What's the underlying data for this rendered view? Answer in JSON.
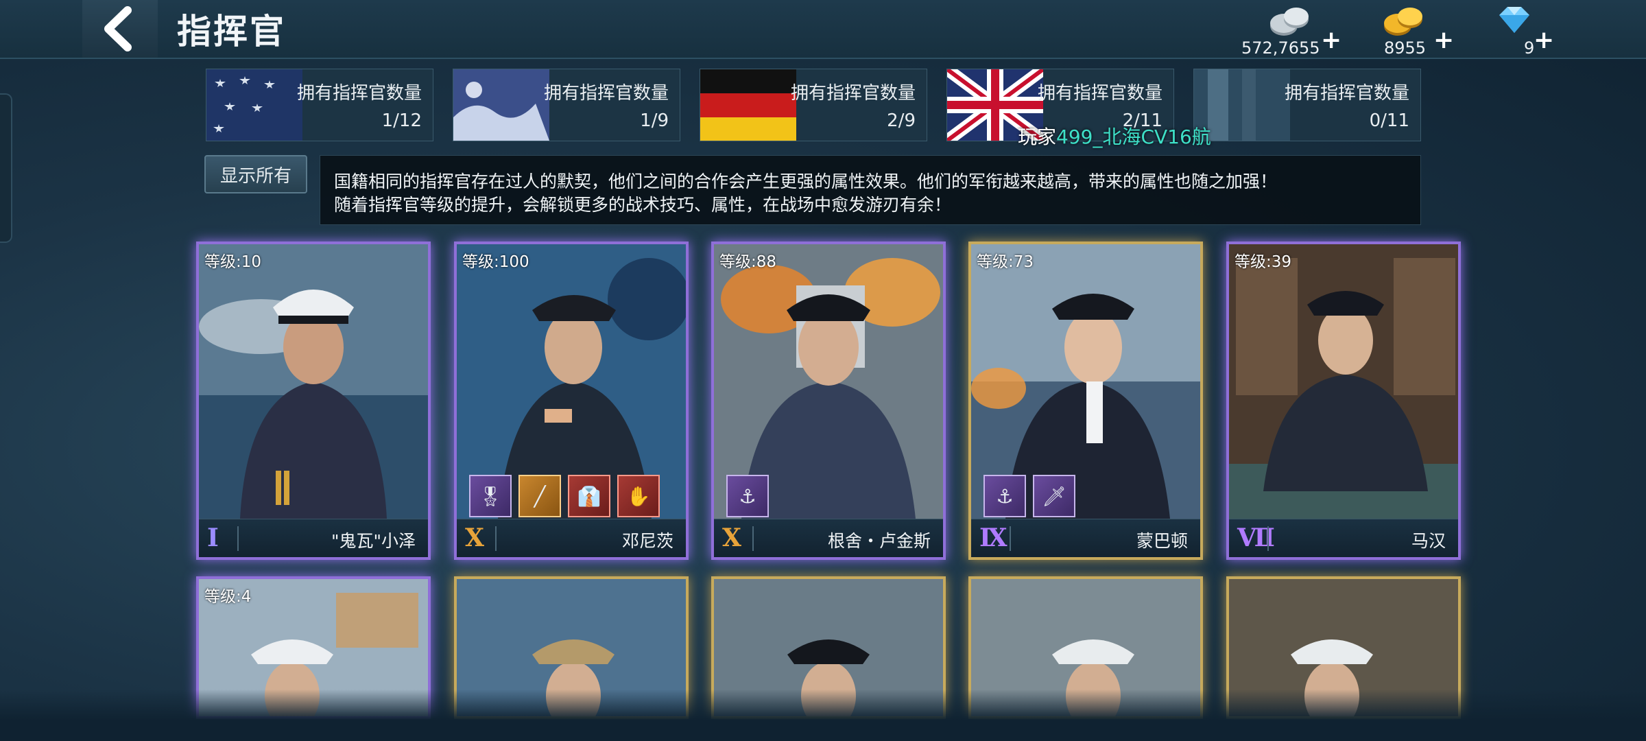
{
  "header": {
    "title": "指挥官",
    "back_icon": "chevron-left-icon",
    "currencies": [
      {
        "name": "silver",
        "icon": "silver-coins-icon",
        "value": "572,7655",
        "plus": "+"
      },
      {
        "name": "gold",
        "icon": "gold-coins-icon",
        "value": "8955",
        "plus": "+"
      },
      {
        "name": "diamond",
        "icon": "diamond-icon",
        "value": "9",
        "plus": "+"
      }
    ]
  },
  "nations": [
    {
      "flag": "usa",
      "label": "拥有指挥官数量",
      "count": "1/12"
    },
    {
      "flag": "japan",
      "label": "拥有指挥官数量",
      "count": "1/9"
    },
    {
      "flag": "germany",
      "label": "拥有指挥官数量",
      "count": "2/9"
    },
    {
      "flag": "uk",
      "label": "拥有指挥官数量",
      "count": "2/11"
    },
    {
      "flag": "other",
      "label": "拥有指挥官数量",
      "count": "0/11"
    }
  ],
  "broadcast": {
    "prefix": "玩家",
    "highlight": "499_北海CV16航"
  },
  "filter": {
    "show_all": "显示所有"
  },
  "description": {
    "line1": "国籍相同的指挥官存在过人的默契，他们之间的合作会产生更强的属性效果。他们的军衔越来越高，带来的属性也随之加强！",
    "line2": "随着指挥官等级的提升，会解锁更多的战术技巧、属性，在战场中愈发游刃有余！"
  },
  "commanders": [
    {
      "level": "等级:10",
      "rank": "Ⅰ",
      "rank_color": "#9a8cff",
      "name": "\"鬼瓦\"小泽",
      "frame": "purple",
      "skills": []
    },
    {
      "level": "等级:100",
      "rank": "Ⅹ",
      "rank_color": "#e7a33a",
      "name": "邓尼茨",
      "frame": "purple",
      "skills": [
        "medal-ribbons-icon",
        "baton-icon",
        "uniform-icon",
        "gloves-icon"
      ]
    },
    {
      "level": "等级:88",
      "rank": "Ⅹ",
      "rank_color": "#e7a33a",
      "name": "根舍・卢金斯",
      "frame": "purple",
      "skills": [
        "submarine-badge-icon"
      ]
    },
    {
      "level": "等级:73",
      "rank": "Ⅸ",
      "rank_color": "#b07bff",
      "name": "蒙巴顿",
      "frame": "gold",
      "skills": [
        "anchor-badge-icon",
        "dagger-icon"
      ]
    },
    {
      "level": "等级:39",
      "rank": "Ⅶ",
      "rank_color": "#b07bff",
      "name": "马汉",
      "frame": "purple",
      "skills": []
    }
  ],
  "commanders_row2": [
    {
      "level": "等级:4",
      "frame": "purple"
    },
    {
      "level": "",
      "frame": "gold"
    },
    {
      "level": "",
      "frame": "gold"
    },
    {
      "level": "",
      "frame": "gold"
    },
    {
      "level": "",
      "frame": "gold"
    }
  ],
  "colors": {
    "accent_purple": "#8f6fd8",
    "accent_gold": "#c7aa5c",
    "highlight_cyan": "#3ee0c8"
  }
}
